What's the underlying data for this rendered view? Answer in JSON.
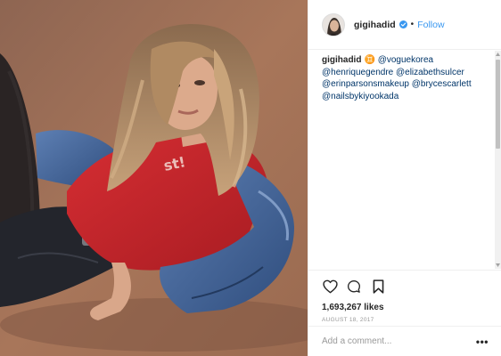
{
  "post": {
    "image_alt": "gigihadid post photo",
    "username": "gigihadid",
    "follow_label": "Follow",
    "separator": "•",
    "verified_icon": "verified-badge-icon",
    "caption": {
      "author": "gigihadid",
      "emoji": "♊",
      "mentions": [
        "@voguekorea",
        "@henriquegendre",
        "@elizabethsulcer",
        "@erinparsonsmakeup",
        "@brycescarlett",
        "@nailsbykiyookada"
      ]
    },
    "likes": "1,693,267 likes",
    "date": "AUGUST 18, 2017",
    "comment_placeholder": "Add a comment...",
    "more_label": "•••",
    "icons": {
      "like": "heart-icon",
      "comment": "comment-icon",
      "save": "bookmark-icon"
    }
  },
  "colors": {
    "accent": "#3897f0",
    "mention": "#003569",
    "photo_background": "#9a6b52",
    "shirt": "#c8242b",
    "denim": "#3d5f95"
  }
}
